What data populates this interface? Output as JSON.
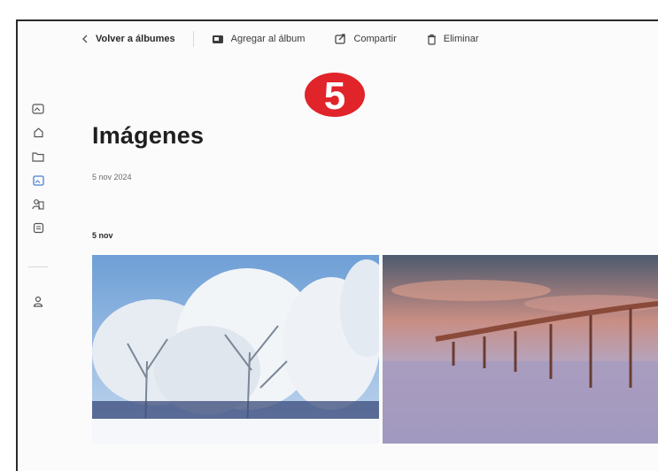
{
  "toolbar": {
    "back_label": "Volver a álbumes",
    "add_label": "Agregar al álbum",
    "share_label": "Compartir",
    "delete_label": "Eliminar"
  },
  "annotation": {
    "step_number": "5",
    "color": "#e1232a"
  },
  "sidebar": {
    "items": [
      {
        "icon": "photo-gallery-icon"
      },
      {
        "icon": "home-icon"
      },
      {
        "icon": "folder-icon"
      },
      {
        "icon": "image-icon",
        "active": true
      },
      {
        "icon": "people-icon"
      },
      {
        "icon": "albums-icon"
      },
      {
        "icon": "person-icon"
      }
    ],
    "active_color": "#4a7fd0"
  },
  "page": {
    "title": "Imágenes",
    "date": "5 nov 2024",
    "group_label": "5 nov"
  },
  "photos": [
    {
      "subject": "snow-covered-trees"
    },
    {
      "subject": "pier-at-sunset"
    }
  ]
}
